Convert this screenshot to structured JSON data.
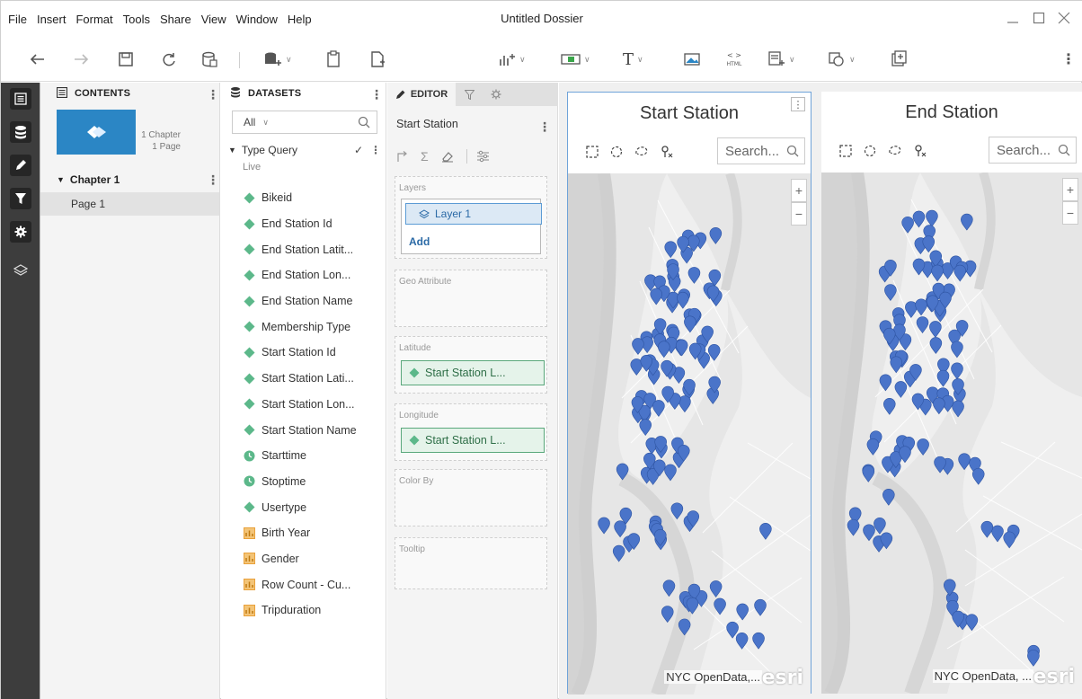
{
  "app": {
    "title": "Untitled Dossier",
    "menu": [
      "File",
      "Insert",
      "Format",
      "Tools",
      "Share",
      "View",
      "Window",
      "Help"
    ]
  },
  "contents": {
    "header": "CONTENTS",
    "thumb_info": [
      "1 Chapter",
      "1 Page"
    ],
    "chapter": "Chapter 1",
    "page": "Page 1"
  },
  "datasets": {
    "header": "DATASETS",
    "filter": "All",
    "query_name": "Type Query",
    "mode": "Live",
    "fields": [
      {
        "label": "Bikeid",
        "type": "attribute"
      },
      {
        "label": "End Station Id",
        "type": "attribute"
      },
      {
        "label": "End Station Latit...",
        "type": "attribute"
      },
      {
        "label": "End Station Lon...",
        "type": "attribute"
      },
      {
        "label": "End Station Name",
        "type": "attribute"
      },
      {
        "label": "Membership Type",
        "type": "attribute"
      },
      {
        "label": "Start Station Id",
        "type": "attribute"
      },
      {
        "label": "Start Station Lati...",
        "type": "attribute"
      },
      {
        "label": "Start Station Lon...",
        "type": "attribute"
      },
      {
        "label": "Start Station Name",
        "type": "attribute"
      },
      {
        "label": "Starttime",
        "type": "time"
      },
      {
        "label": "Stoptime",
        "type": "time"
      },
      {
        "label": "Usertype",
        "type": "attribute"
      },
      {
        "label": "Birth Year",
        "type": "metric"
      },
      {
        "label": "Gender",
        "type": "metric"
      },
      {
        "label": "Row Count - Cu...",
        "type": "metric"
      },
      {
        "label": "Tripduration",
        "type": "metric"
      }
    ]
  },
  "editor": {
    "tab_label": "EDITOR",
    "viz_title": "Start Station",
    "zones": {
      "layers": "Layers",
      "layer_name": "Layer 1",
      "add": "Add",
      "geo": "Geo Attribute",
      "latitude": "Latitude",
      "latitude_value": "Start Station L...",
      "longitude": "Longitude",
      "longitude_value": "Start Station L...",
      "color_by": "Color By",
      "tooltip": "Tooltip"
    }
  },
  "maps": [
    {
      "title": "Start Station",
      "search_placeholder": "Search...",
      "attribution": "NYC OpenData,...",
      "logo": "esri"
    },
    {
      "title": "End Station",
      "search_placeholder": "Search...",
      "attribution": "NYC OpenData, ...",
      "logo": "esri"
    }
  ],
  "colors": {
    "rail": "#3d3d3d",
    "accent": "#2b86c5",
    "pin": "#4a74c9",
    "attribute": "#5cb88a",
    "metric": "#e9a13b",
    "time": "#5cb88a"
  }
}
